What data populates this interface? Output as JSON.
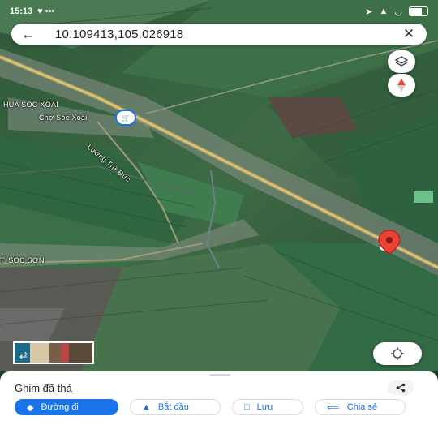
{
  "status_bar": {
    "time": "15:13",
    "battery": "75"
  },
  "search": {
    "query": "10.109413,105.026918"
  },
  "map": {
    "labels": {
      "town_top": "HUA SOC XOAI",
      "market": "Chợ Sóc Xoài",
      "road": "Lương Trứ Đức",
      "town_left": "T. SOC SƠN"
    },
    "pin_color": "#ea4335",
    "blue_dot_color": "#4285f4"
  },
  "sheet": {
    "title": "Ghim đã thả",
    "actions": [
      {
        "label": "Đường đi",
        "icon": "directions-icon"
      },
      {
        "label": "Bắt đầu",
        "icon": "navigation-icon"
      },
      {
        "label": "Lưu",
        "icon": "bookmark-icon"
      },
      {
        "label": "Chia sẻ",
        "icon": "share-icon"
      }
    ]
  },
  "colors": {
    "accent": "#1a73e8",
    "sheet_bg": "#ffffff"
  }
}
